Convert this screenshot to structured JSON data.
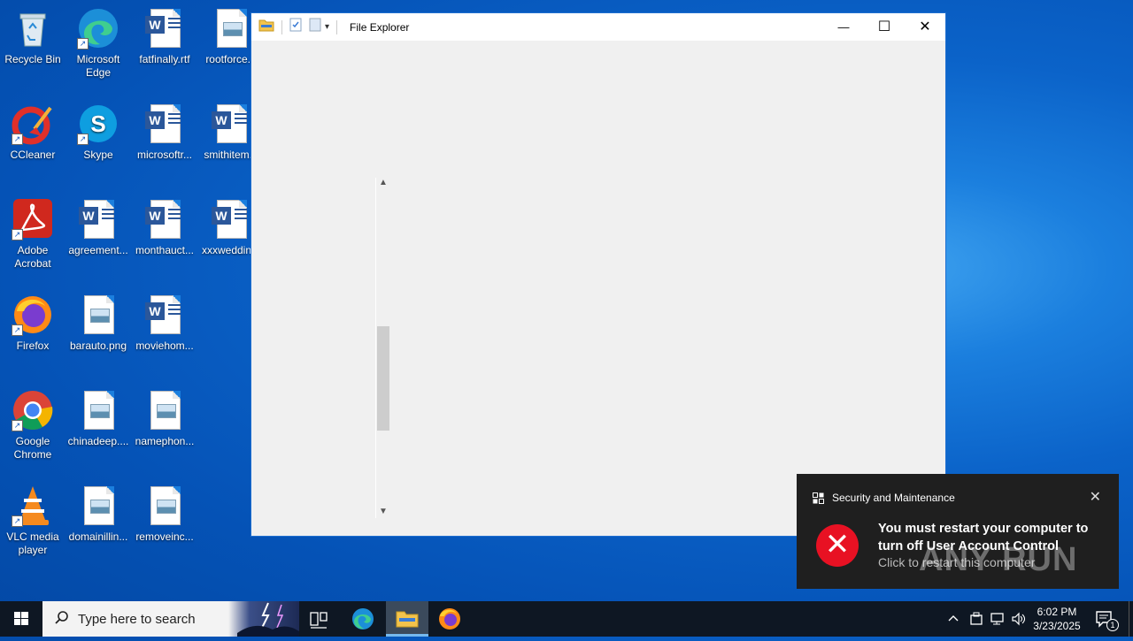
{
  "desktop": {
    "icons": [
      {
        "label": "Recycle Bin"
      },
      {
        "label": "Microsoft Edge"
      },
      {
        "label": "fatfinally.rtf"
      },
      {
        "label": "rootforce..."
      },
      {
        "label": "CCleaner"
      },
      {
        "label": "Skype"
      },
      {
        "label": "microsoftr..."
      },
      {
        "label": "smithitem..."
      },
      {
        "label": "Adobe Acrobat"
      },
      {
        "label": "agreement..."
      },
      {
        "label": "monthauct..."
      },
      {
        "label": "xxxweddin..."
      },
      {
        "label": "Firefox"
      },
      {
        "label": "barauto.png"
      },
      {
        "label": "moviehom..."
      },
      {
        "label": "Google Chrome"
      },
      {
        "label": "chinadeep...."
      },
      {
        "label": "namephon..."
      },
      {
        "label": "VLC media player"
      },
      {
        "label": "domainillin..."
      },
      {
        "label": "removeinc..."
      }
    ]
  },
  "window": {
    "title": "File Explorer",
    "minimize": "—",
    "maximize": "☐",
    "close": "✕"
  },
  "taskbar": {
    "search_placeholder": "Type here to search",
    "time": "6:02 PM",
    "date": "3/23/2025",
    "notification_count": "1"
  },
  "toast": {
    "app_name": "Security and Maintenance",
    "headline": "You must restart your computer to turn off User Account Control",
    "subtext": "Click to restart this computer"
  },
  "watermark": "ANY RUN"
}
